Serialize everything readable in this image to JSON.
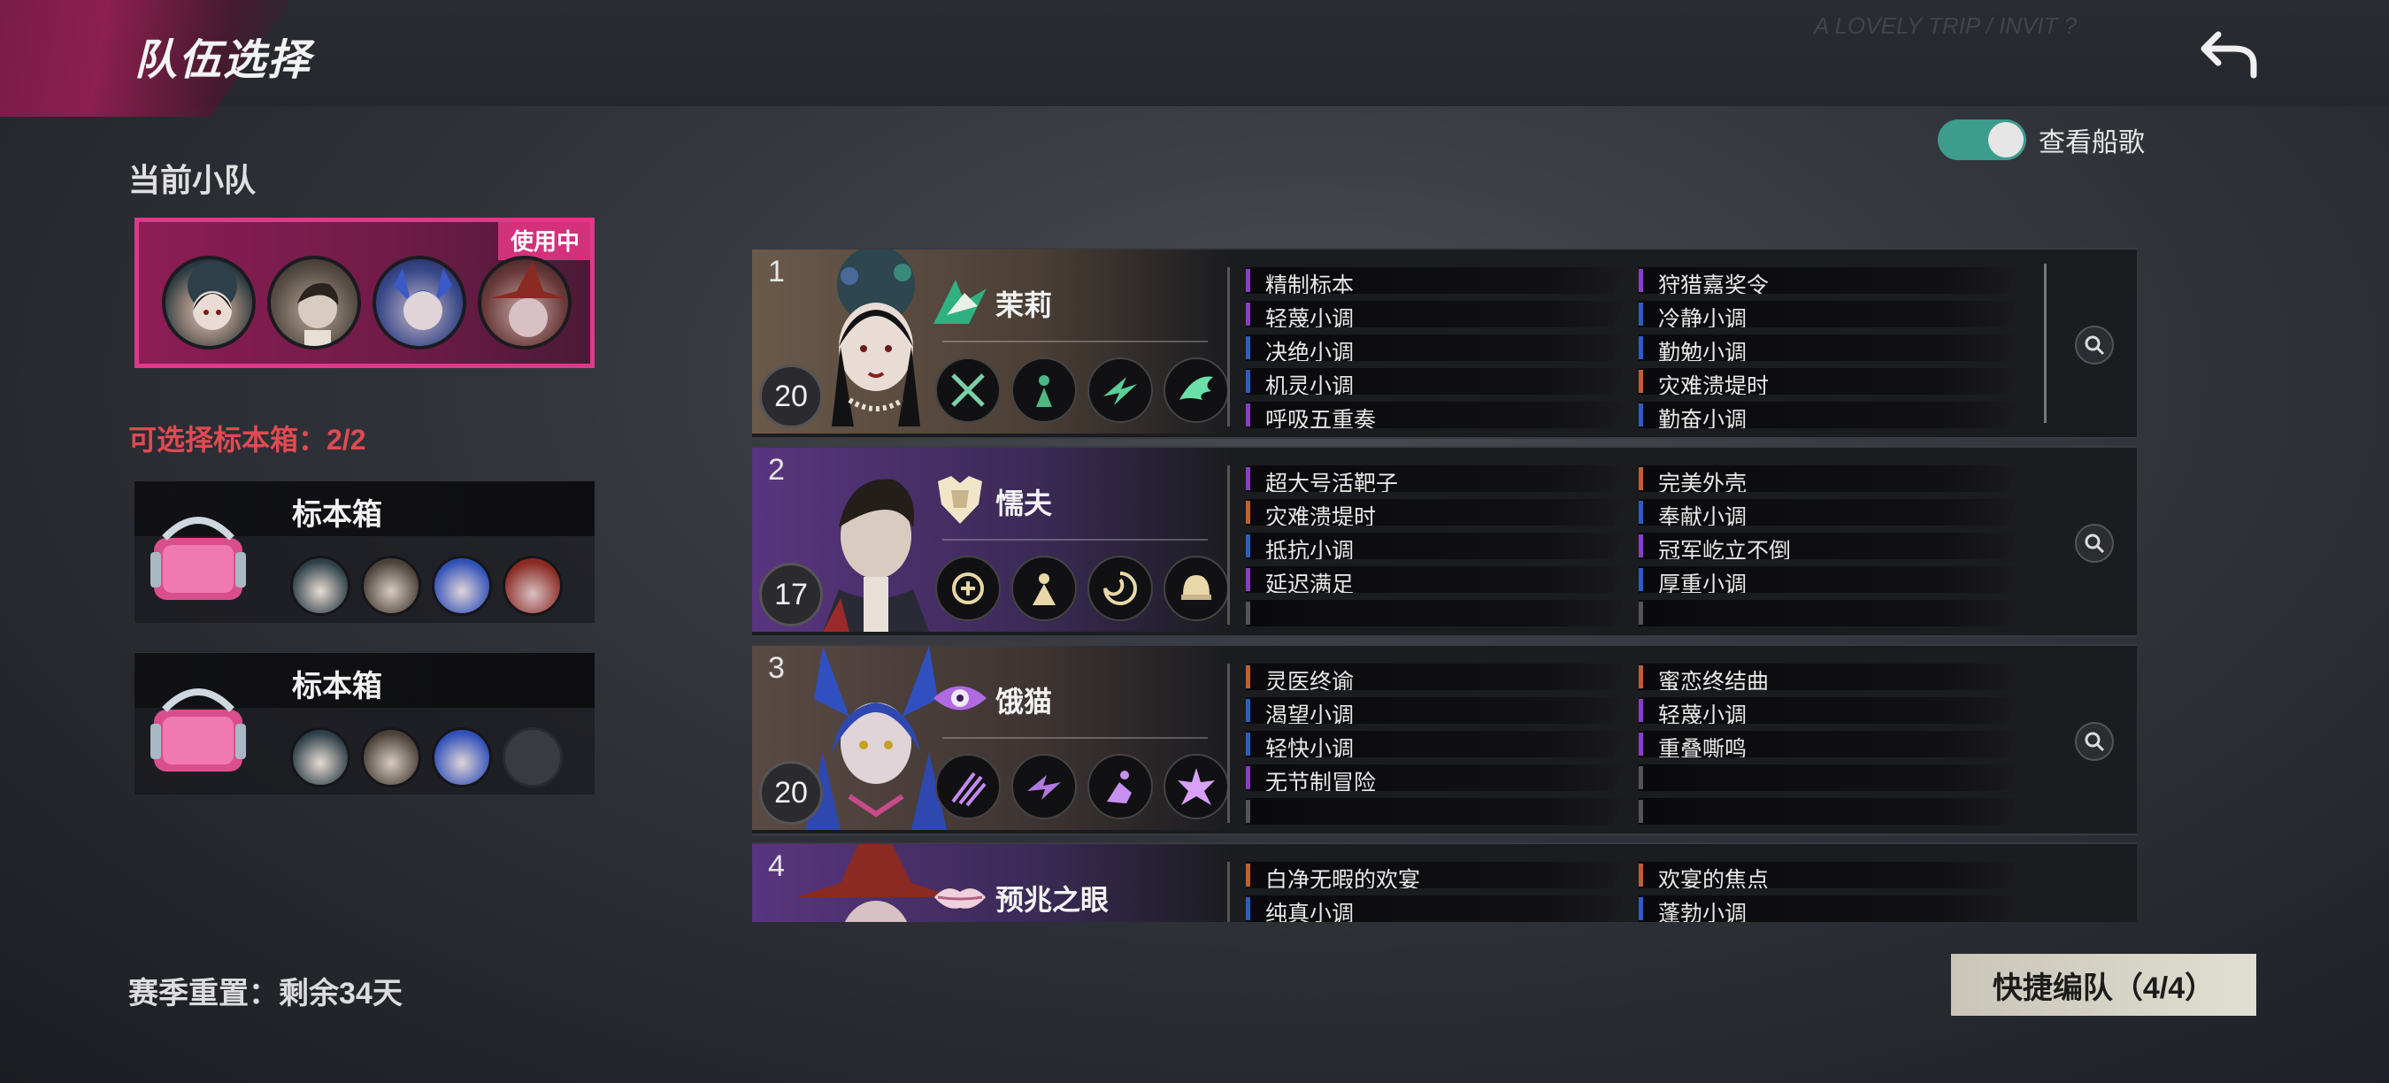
{
  "header": {
    "title": "队伍选择",
    "deco": "A LOVELY TRIP / INVIT ?"
  },
  "toggle": {
    "label": "查看船歌",
    "on": true,
    "color": "#3e9c8c"
  },
  "current_team": {
    "label": "当前小队",
    "badge": "使用中"
  },
  "box_section": {
    "label": "可选择标本箱：2/2"
  },
  "boxes": [
    {
      "name": "标本箱",
      "filled": 4
    },
    {
      "name": "标本箱",
      "filled": 3
    }
  ],
  "season": "赛季重置：剩余34天",
  "quick_button": "快捷编队（4/4）",
  "characters": [
    {
      "rank": "1",
      "level": "20",
      "name": "茉莉",
      "theme": "#6b5a4a",
      "tags_left": [
        {
          "t": "精制标本",
          "c": "#8c3cc8"
        },
        {
          "t": "轻蔑小调",
          "c": "#8c3cc8"
        },
        {
          "t": "决绝小调",
          "c": "#2a5fc0"
        },
        {
          "t": "机灵小调",
          "c": "#2a5fc0"
        },
        {
          "t": "呼吸五重奏",
          "c": "#8c3cc8"
        }
      ],
      "tags_right": [
        {
          "t": "狩猎嘉奖令",
          "c": "#8c3cc8"
        },
        {
          "t": "冷静小调",
          "c": "#2a5fc0"
        },
        {
          "t": "勤勉小调",
          "c": "#2a5fc0"
        },
        {
          "t": "灾难溃堤时",
          "c": "#c0602a"
        },
        {
          "t": "勤奋小调",
          "c": "#2a5fc0"
        }
      ]
    },
    {
      "rank": "2",
      "level": "17",
      "name": "懦夫",
      "theme": "#5a3580",
      "tags_left": [
        {
          "t": "超大号活靶子",
          "c": "#8c3cc8"
        },
        {
          "t": "灾难溃堤时",
          "c": "#c0602a"
        },
        {
          "t": "抵抗小调",
          "c": "#2a5fc0"
        },
        {
          "t": "延迟满足",
          "c": "#8c3cc8"
        },
        {
          "t": "",
          "c": "#555555"
        }
      ],
      "tags_right": [
        {
          "t": "完美外壳",
          "c": "#c0602a"
        },
        {
          "t": "奉献小调",
          "c": "#2a5fc0"
        },
        {
          "t": "冠军屹立不倒",
          "c": "#8c3cc8"
        },
        {
          "t": "厚重小调",
          "c": "#2a5fc0"
        },
        {
          "t": "",
          "c": "#555555"
        }
      ]
    },
    {
      "rank": "3",
      "level": "20",
      "name": "饿猫",
      "theme": "#5a4a44",
      "tags_left": [
        {
          "t": "灵医终谕",
          "c": "#c0602a"
        },
        {
          "t": "渴望小调",
          "c": "#2a5fc0"
        },
        {
          "t": "轻快小调",
          "c": "#2a5fc0"
        },
        {
          "t": "无节制冒险",
          "c": "#8c3cc8"
        },
        {
          "t": "",
          "c": "#555555"
        }
      ],
      "tags_right": [
        {
          "t": "蜜恋终结曲",
          "c": "#c0602a"
        },
        {
          "t": "轻蔑小调",
          "c": "#8c3cc8"
        },
        {
          "t": "重叠嘶鸣",
          "c": "#8c3cc8"
        },
        {
          "t": "",
          "c": "#555555"
        },
        {
          "t": "",
          "c": "#555555"
        }
      ]
    },
    {
      "rank": "4",
      "level": "",
      "name": "预兆之眼",
      "theme": "#5a3580",
      "tags_left": [
        {
          "t": "白净无暇的欢宴",
          "c": "#c0602a"
        },
        {
          "t": "纯真小调",
          "c": "#2a5fc0"
        },
        {
          "t": "",
          "c": "#555555"
        },
        {
          "t": "",
          "c": "#555555"
        },
        {
          "t": "",
          "c": "#555555"
        }
      ],
      "tags_right": [
        {
          "t": "欢宴的焦点",
          "c": "#c0602a"
        },
        {
          "t": "蓬勃小调",
          "c": "#2a5fc0"
        },
        {
          "t": "",
          "c": "#555555"
        },
        {
          "t": "",
          "c": "#555555"
        },
        {
          "t": "",
          "c": "#555555"
        }
      ]
    }
  ],
  "icons": {
    "back": "back-arrow-icon",
    "inspect": "magnifier-icon",
    "box": "specimen-box-icon"
  }
}
